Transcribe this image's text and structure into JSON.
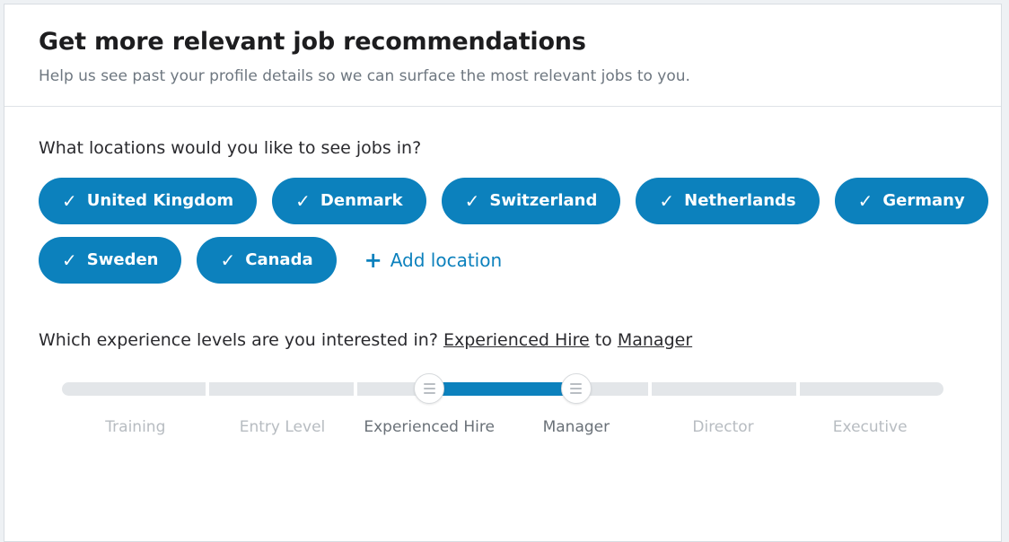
{
  "theme": {
    "accent": "#0c81bd",
    "track": "#e3e6e9",
    "page_bg": "#eef1f4",
    "card_bg": "#ffffff",
    "border": "#d8dde2"
  },
  "header": {
    "title": "Get more relevant job recommendations",
    "subtitle": "Help us see past your profile details so we can surface the most relevant jobs to you."
  },
  "locations": {
    "question": "What locations would you like to see jobs in?",
    "check_glyph": "✓",
    "selected": [
      "United Kingdom",
      "Denmark",
      "Switzerland",
      "Netherlands",
      "Germany",
      "Sweden",
      "Canada"
    ],
    "add_label": "Add location",
    "add_plus": "+"
  },
  "experience": {
    "question_prefix": "Which experience levels are you interested in?",
    "range_from": "Experienced Hire",
    "range_joiner": "to",
    "range_to": "Manager",
    "levels": [
      "Training",
      "Entry Level",
      "Experienced Hire",
      "Manager",
      "Director",
      "Executive"
    ],
    "selected_start_index": 2,
    "selected_end_index": 3,
    "handle_grip_lines": 3
  }
}
